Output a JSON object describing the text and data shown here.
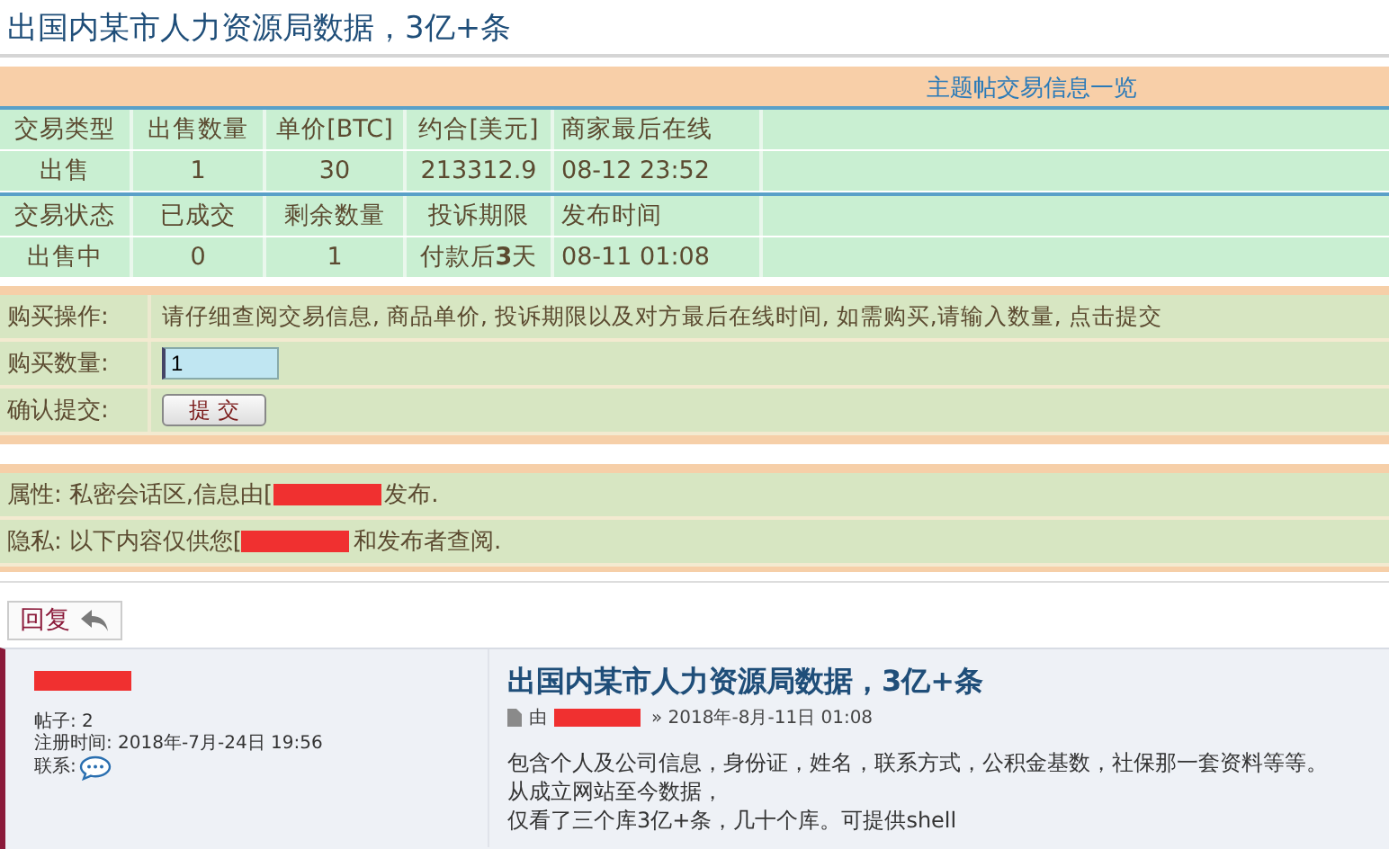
{
  "page_title": "出国内某市人力资源局数据，3亿+条",
  "trade_table": {
    "link": "主题帖交易信息一览",
    "rows": [
      {
        "kind": "header",
        "cells": [
          "交易类型",
          "出售数量",
          "单价[BTC]",
          "约合[美元]",
          "商家最后在线"
        ]
      },
      {
        "kind": "value",
        "cells": [
          "出售",
          "1",
          "30",
          "213312.9",
          "08-12 23:52"
        ]
      },
      {
        "kind": "header",
        "cells": [
          "交易状态",
          "已成交",
          "剩余数量",
          "投诉期限",
          "发布时间"
        ]
      },
      {
        "kind": "value",
        "cells": [
          "出售中",
          "0",
          "1",
          "付款后**3**天",
          "08-11 01:08"
        ]
      }
    ]
  },
  "purchase": {
    "rows": [
      {
        "kind": "text",
        "label": "购买操作:",
        "text": "请仔细查阅交易信息, 商品单价, 投诉期限以及对方最后在线时间, 如需购买,请输入数量, 点击提交"
      },
      {
        "kind": "input",
        "label": "购买数量:",
        "value": "1"
      },
      {
        "kind": "button",
        "label": "确认提交:",
        "button": "提 交"
      }
    ]
  },
  "attributes": [
    {
      "label": "属性:",
      "before": "私密会话区,信息由[",
      "after": "发布."
    },
    {
      "label": "隐私:",
      "before": "以下内容仅供您[",
      "after": "和发布者查阅."
    }
  ],
  "reply_button": "回复",
  "post": {
    "author_stats": [
      {
        "kind": "text",
        "label": "帖子:",
        "value": "2"
      },
      {
        "kind": "text",
        "label": "注册时间:",
        "value": "2018年-7月-24日 19:56"
      },
      {
        "kind": "contact",
        "label": "联系:"
      }
    ],
    "title": "出国内某市人力资源局数据，3亿+条",
    "by": "由",
    "date": "» 2018年-8月-11日 01:08",
    "body": [
      "包含个人及公司信息，身份证，姓名，联系方式，公积金基数，社保那一套资料等等。",
      "从成立网站至今数据，",
      "仅看了三个库3亿+条，几十个库。可提供shell"
    ]
  }
}
